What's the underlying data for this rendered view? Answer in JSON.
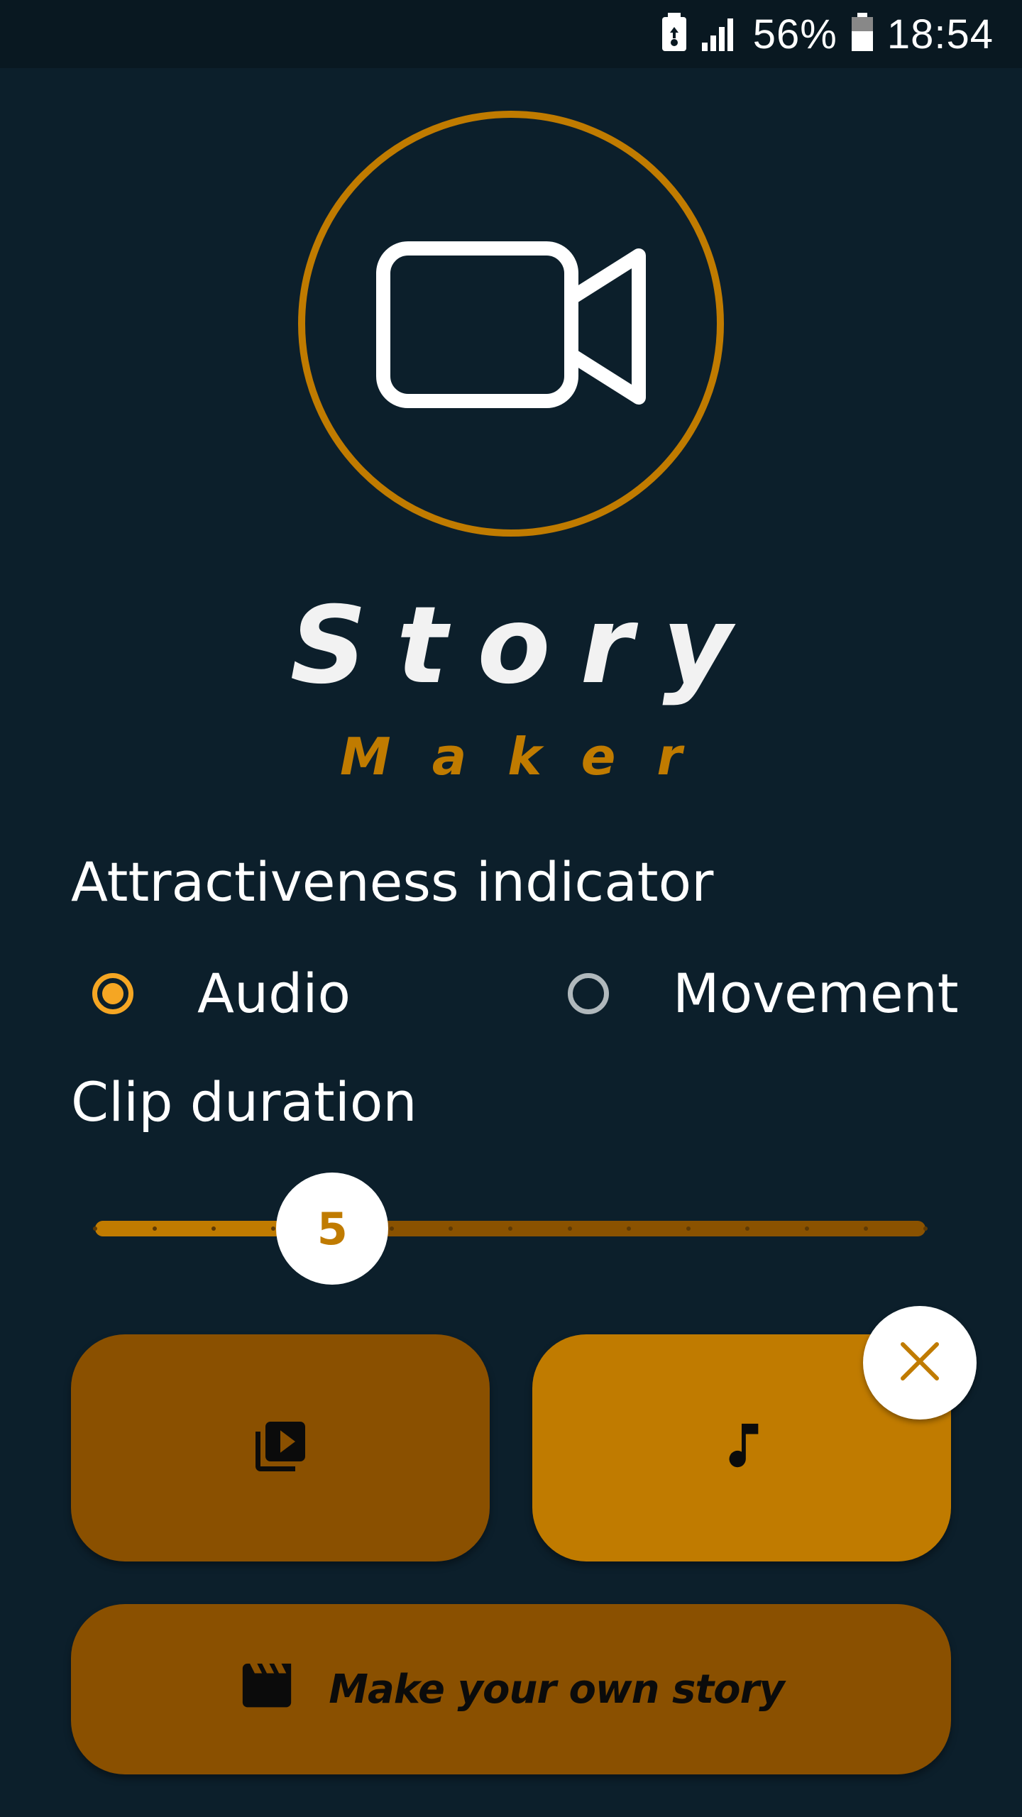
{
  "status_bar": {
    "battery_percent": "56%",
    "time": "18:54",
    "icons": [
      "battery-saver-icon",
      "signal-icon",
      "battery-icon"
    ]
  },
  "app": {
    "title_line1": "Story",
    "title_line2": "Maker",
    "logo_icon": "video-camera-icon"
  },
  "attractiveness": {
    "label": "Attractiveness indicator",
    "options": [
      {
        "label": "Audio",
        "selected": true
      },
      {
        "label": "Movement",
        "selected": false
      }
    ]
  },
  "clip_duration": {
    "label": "Clip duration",
    "value": "5",
    "min": 1,
    "max": 15,
    "current": 5
  },
  "actions": {
    "video_button_icon": "video-library-icon",
    "audio_button_icon": "music-note-icon",
    "clear_audio_icon": "close-icon",
    "make_story_label": "Make your own story",
    "make_story_icon": "clapperboard-icon"
  },
  "colors": {
    "background": "#0c1f2b",
    "accent": "#c07b00",
    "accent_dark": "#8a5000",
    "radio_selected": "#f5a623"
  }
}
